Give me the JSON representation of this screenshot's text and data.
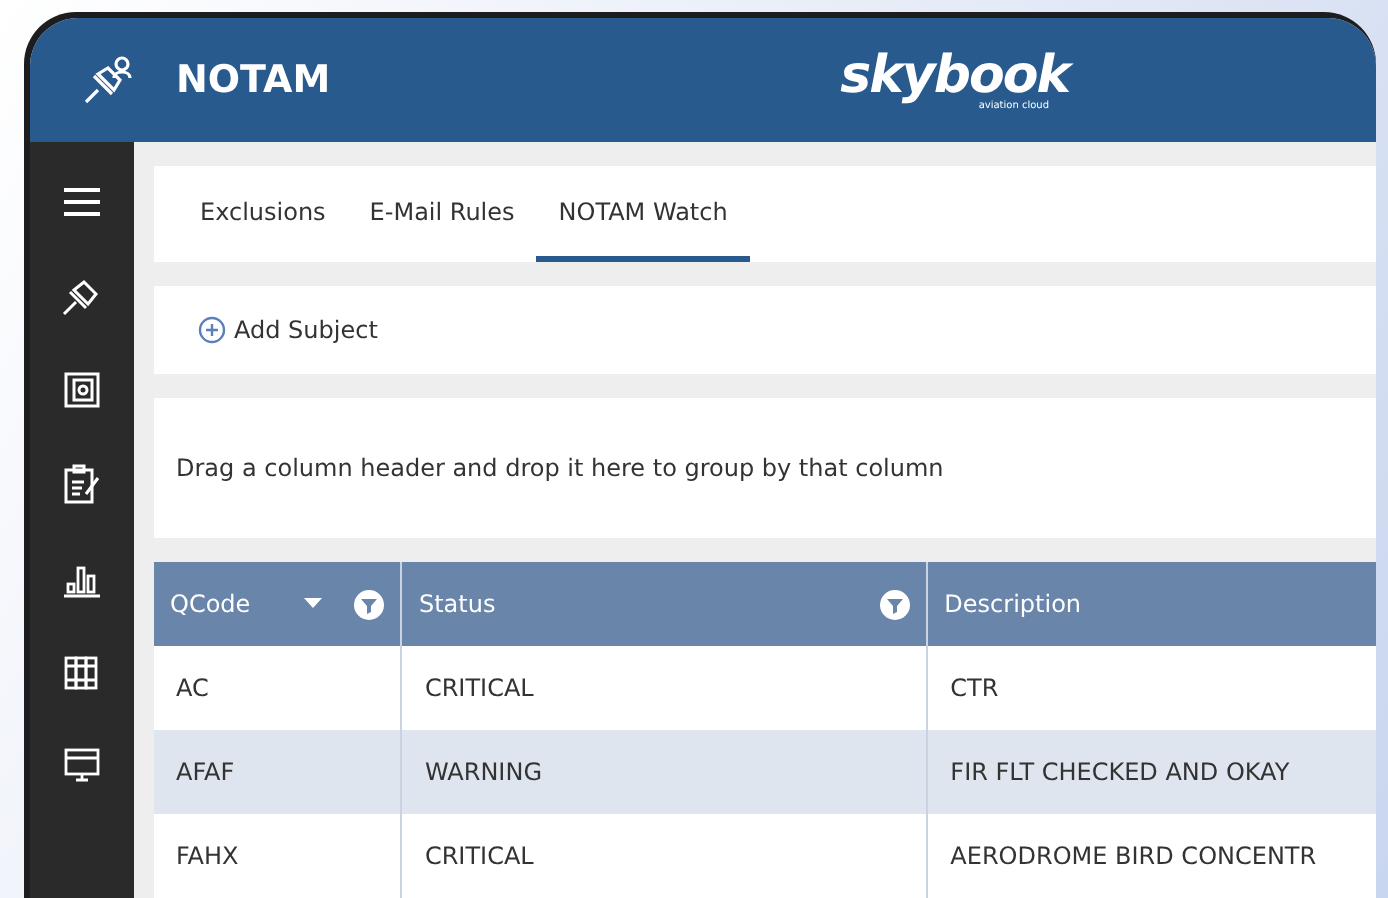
{
  "header": {
    "title": "NOTAM",
    "logo": "skybook",
    "logo_tagline": "aviation cloud"
  },
  "tabs": [
    {
      "label": "Exclusions",
      "selected": false
    },
    {
      "label": "E-Mail Rules",
      "selected": false
    },
    {
      "label": "NOTAM Watch",
      "selected": true
    }
  ],
  "add_subject_button": "Add Subject",
  "group_panel": "Drag a column header and drop it here to group by that column",
  "table": {
    "columns": [
      {
        "label": "QCode",
        "sorted_descending": true,
        "filterable": true
      },
      {
        "label": "Status",
        "sorted_descending": false,
        "filterable": true
      },
      {
        "label": "Description",
        "sorted_descending": false,
        "filterable": false
      }
    ],
    "rows": [
      [
        "AC",
        "CRITICAL",
        "CTR"
      ],
      [
        "AFAF",
        "WARNING",
        "FIR FLT CHECKED AND OKAY"
      ],
      [
        "FAHX",
        "CRITICAL",
        "AERODROME BIRD CONCENTR"
      ]
    ]
  }
}
